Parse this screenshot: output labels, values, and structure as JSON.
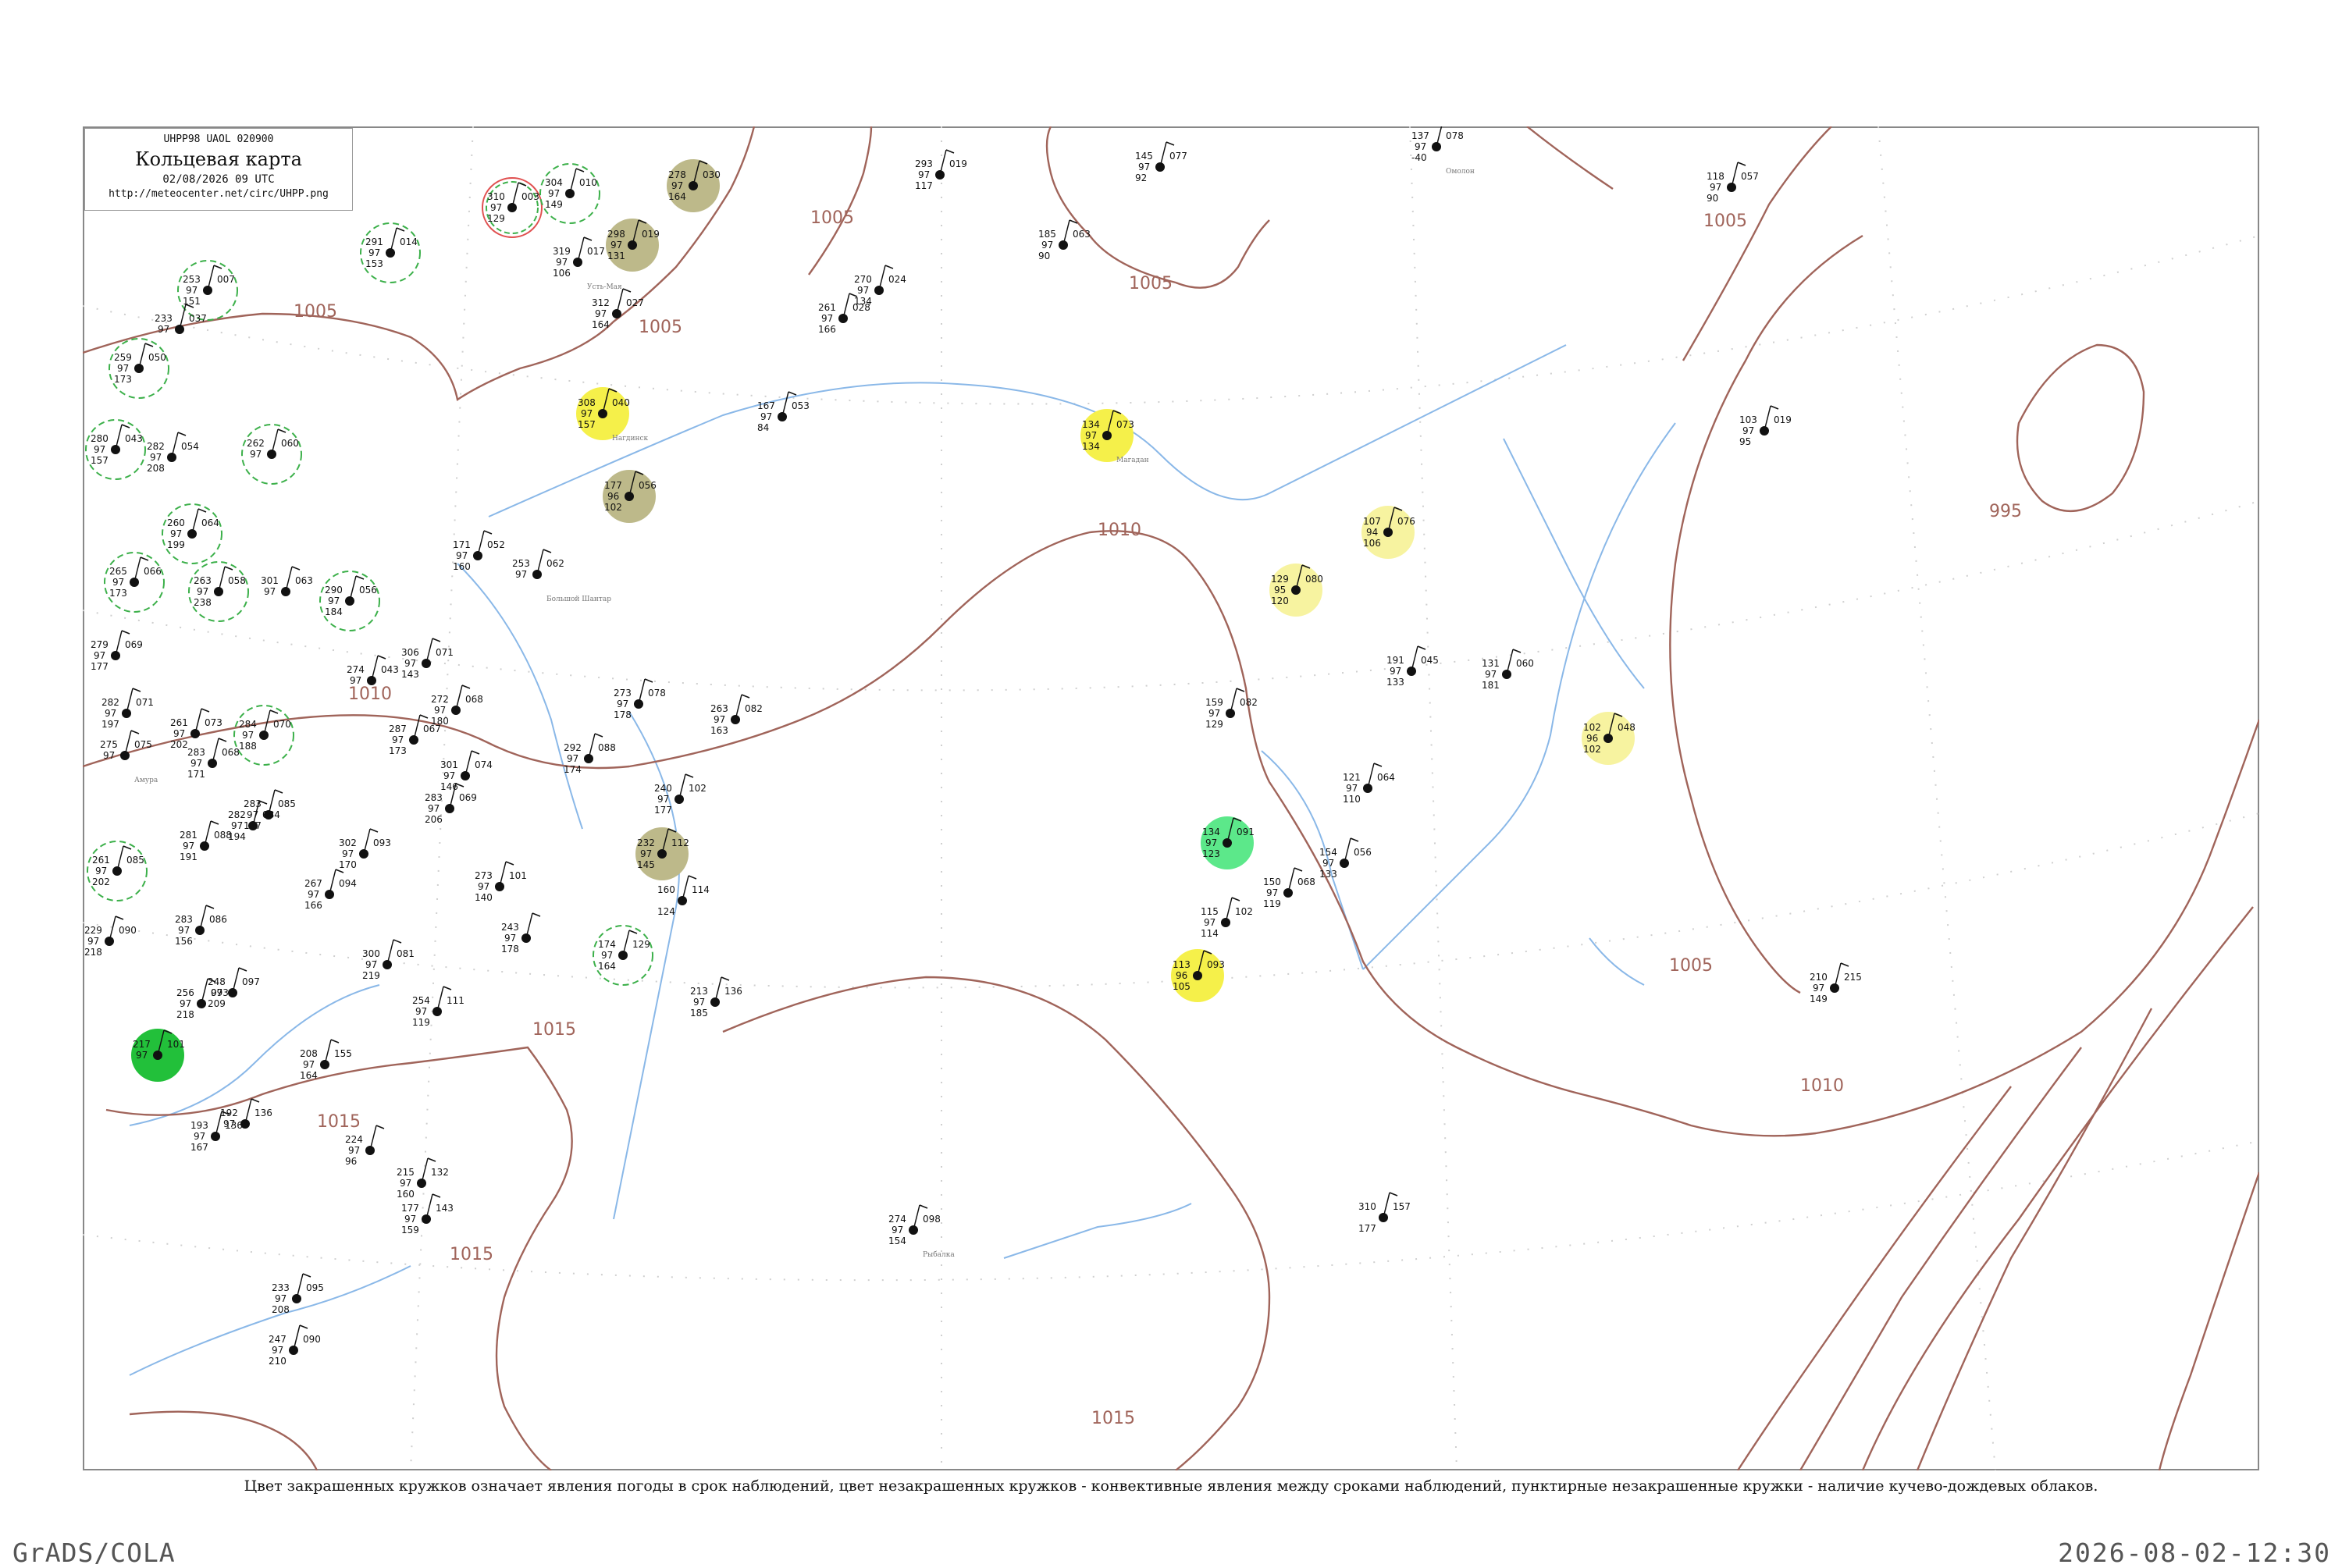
{
  "header": {
    "code": "UHPP98  UAOL  020900",
    "title": "Кольцевая карта",
    "date": "02/08/2026 09 UTC",
    "url": "http://meteocenter.net/circ/UHPP.png"
  },
  "caption": "Цвет закрашенных кружков означает явления погоды в срок наблюдений, цвет незакрашенных кружков - конвективные явления между сроками наблюдений, пунктирные незакрашенные кружки - наличие кучево-дождевых облаков.",
  "footer": {
    "left": "GrADS/COLA",
    "right": "2026-08-02-12:30"
  },
  "colors": {
    "isobar": "#a0645a",
    "river": "#8ab8e8",
    "dashed_circle": "#3cb04a",
    "yellow": "#f5f04a",
    "olive": "#bdb98a",
    "green": "#22c03a",
    "mint": "#5ce88a",
    "pale_yellow": "#f7f3a0",
    "red_circle": "#e05050"
  },
  "isobar_labels": [
    {
      "id": "a",
      "text": "1005"
    },
    {
      "id": "b",
      "text": "1005"
    },
    {
      "id": "c",
      "text": "1005"
    },
    {
      "id": "d",
      "text": "1005"
    },
    {
      "id": "e",
      "text": "1005"
    },
    {
      "id": "f",
      "text": "1005"
    },
    {
      "id": "g",
      "text": "995"
    },
    {
      "id": "h",
      "text": "1010"
    },
    {
      "id": "i",
      "text": "1010"
    },
    {
      "id": "j",
      "text": "1010"
    },
    {
      "id": "k",
      "text": "1015"
    },
    {
      "id": "l",
      "text": "1015"
    },
    {
      "id": "m",
      "text": "1015"
    },
    {
      "id": "n",
      "text": "1015"
    }
  ],
  "stations": [
    {
      "p": "310",
      "v": "97",
      "t": "129",
      "d": "003",
      "name": "",
      "mark": "red"
    },
    {
      "p": "304",
      "v": "97",
      "t": "149",
      "d": "010",
      "name": "",
      "mark": "dashed"
    },
    {
      "p": "278",
      "v": "97",
      "t": "164",
      "d": "030",
      "name": "",
      "mark": "olive"
    },
    {
      "p": "319",
      "v": "97",
      "t": "106",
      "d": "017",
      "name": "Усть-Мая",
      "mark": "none"
    },
    {
      "p": "298",
      "v": "97",
      "t": "131",
      "d": "019",
      "name": "",
      "mark": "olive"
    },
    {
      "p": "312",
      "v": "97",
      "t": "164",
      "d": "027",
      "name": "",
      "mark": "none"
    },
    {
      "p": "308",
      "v": "97",
      "t": "157",
      "d": "040",
      "name": "Нагдинск",
      "mark": "yellow"
    },
    {
      "p": "291",
      "v": "97",
      "t": "153",
      "d": "014",
      "name": "",
      "mark": "dashed"
    },
    {
      "p": "253",
      "v": "97",
      "t": "151",
      "d": "007",
      "name": "",
      "mark": "dashed"
    },
    {
      "p": "233",
      "v": "97",
      "t": "",
      "d": "037",
      "name": "",
      "mark": "none"
    },
    {
      "p": "259",
      "v": "97",
      "t": "173",
      "d": "050",
      "name": "",
      "mark": "dashed"
    },
    {
      "p": "280",
      "v": "97",
      "t": "157",
      "d": "043",
      "name": "",
      "mark": "dashed"
    },
    {
      "p": "282",
      "v": "97",
      "t": "208",
      "d": "054",
      "name": "",
      "mark": "none"
    },
    {
      "p": "262",
      "v": "97",
      "t": "",
      "d": "060",
      "name": "",
      "mark": "dashed"
    },
    {
      "p": "260",
      "v": "97",
      "t": "199",
      "d": "064",
      "name": "",
      "mark": "dashed"
    },
    {
      "p": "265",
      "v": "97",
      "t": "173",
      "d": "066",
      "name": "",
      "mark": "dashed"
    },
    {
      "p": "263",
      "v": "97",
      "t": "238",
      "d": "058",
      "name": "",
      "mark": "dashed"
    },
    {
      "p": "301",
      "v": "97",
      "t": "",
      "d": "063",
      "name": "",
      "mark": "none"
    },
    {
      "p": "290",
      "v": "97",
      "t": "184",
      "d": "056",
      "name": "",
      "mark": "dashed"
    },
    {
      "p": "279",
      "v": "97",
      "t": "177",
      "d": "069",
      "name": "",
      "mark": "none"
    },
    {
      "p": "282",
      "v": "97",
      "t": "197",
      "d": "071",
      "name": "",
      "mark": "none"
    },
    {
      "p": "261",
      "v": "97",
      "t": "202",
      "d": "073",
      "name": "",
      "mark": "none"
    },
    {
      "p": "284",
      "v": "97",
      "t": "188",
      "d": "070",
      "name": "",
      "mark": "dashed"
    },
    {
      "p": "275",
      "v": "97",
      "t": "",
      "d": "075",
      "name": "Амура",
      "mark": "none"
    },
    {
      "p": "283",
      "v": "97",
      "t": "171",
      "d": "068",
      "name": "",
      "mark": "none"
    },
    {
      "p": "283",
      "v": "97",
      "t": "197",
      "d": "085",
      "name": "",
      "mark": "none"
    },
    {
      "p": "282",
      "v": "97",
      "t": "194",
      "d": "084",
      "name": "",
      "mark": "none"
    },
    {
      "p": "281",
      "v": "97",
      "t": "191",
      "d": "088",
      "name": "",
      "mark": "none"
    },
    {
      "p": "261",
      "v": "97",
      "t": "202",
      "d": "085",
      "name": "",
      "mark": "dashed"
    },
    {
      "p": "229",
      "v": "97",
      "t": "218",
      "d": "090",
      "name": "",
      "mark": "none"
    },
    {
      "p": "283",
      "v": "97",
      "t": "156",
      "d": "086",
      "name": "",
      "mark": "none"
    },
    {
      "p": "248",
      "v": "97",
      "t": "209",
      "d": "097",
      "name": "",
      "mark": "none"
    },
    {
      "p": "256",
      "v": "97",
      "t": "218",
      "d": "093",
      "name": "",
      "mark": "none"
    },
    {
      "p": "217",
      "v": "97",
      "t": "",
      "d": "101",
      "name": "",
      "mark": "green"
    },
    {
      "p": "274",
      "v": "97",
      "t": "",
      "d": "043",
      "name": "",
      "mark": "none"
    },
    {
      "p": "306",
      "v": "97",
      "t": "143",
      "d": "071",
      "name": "",
      "mark": "none"
    },
    {
      "p": "272",
      "v": "97",
      "t": "180",
      "d": "068",
      "name": "",
      "mark": "none"
    },
    {
      "p": "287",
      "v": "97",
      "t": "173",
      "d": "067",
      "name": "",
      "mark": "none"
    },
    {
      "p": "301",
      "v": "97",
      "t": "146",
      "d": "074",
      "name": "",
      "mark": "none"
    },
    {
      "p": "283",
      "v": "97",
      "t": "206",
      "d": "069",
      "name": "",
      "mark": "none"
    },
    {
      "p": "302",
      "v": "97",
      "t": "170",
      "d": "093",
      "name": "",
      "mark": "none"
    },
    {
      "p": "267",
      "v": "97",
      "t": "166",
      "d": "094",
      "name": "",
      "mark": "none"
    },
    {
      "p": "300",
      "v": "97",
      "t": "219",
      "d": "081",
      "name": "",
      "mark": "none"
    },
    {
      "p": "254",
      "v": "97",
      "t": "119",
      "d": "111",
      "name": "",
      "mark": "none"
    },
    {
      "p": "208",
      "v": "97",
      "t": "164",
      "d": "155",
      "name": "",
      "mark": "none"
    },
    {
      "p": "193",
      "v": "97",
      "t": "167",
      "d": "136",
      "name": "",
      "mark": "none"
    },
    {
      "p": "192",
      "v": "97",
      "t": "",
      "d": "136",
      "name": "",
      "mark": "none"
    },
    {
      "p": "171",
      "v": "97",
      "t": "160",
      "d": "052",
      "name": "",
      "mark": "none"
    },
    {
      "p": "253",
      "v": "97",
      "t": "",
      "d": "062",
      "name": "Большой Шантар",
      "mark": "none"
    },
    {
      "p": "177",
      "v": "96",
      "t": "102",
      "d": "056",
      "name": "",
      "mark": "olive"
    },
    {
      "p": "167",
      "v": "97",
      "t": "84",
      "d": "053",
      "name": "",
      "mark": "none"
    },
    {
      "p": "273",
      "v": "97",
      "t": "178",
      "d": "078",
      "name": "",
      "mark": "none"
    },
    {
      "p": "263",
      "v": "97",
      "t": "163",
      "d": "082",
      "name": "",
      "mark": "none"
    },
    {
      "p": "292",
      "v": "97",
      "t": "174",
      "d": "088",
      "name": "",
      "mark": "none"
    },
    {
      "p": "240",
      "v": "97",
      "t": "177",
      "d": "102",
      "name": "",
      "mark": "none"
    },
    {
      "p": "232",
      "v": "97",
      "t": "145",
      "d": "112",
      "name": "",
      "mark": "olive"
    },
    {
      "p": "273",
      "v": "97",
      "t": "140",
      "d": "101",
      "name": "",
      "mark": "none"
    },
    {
      "p": "243",
      "v": "97",
      "t": "178",
      "d": "",
      "name": "",
      "mark": "none"
    },
    {
      "p": "174",
      "v": "97",
      "t": "164",
      "d": "129",
      "name": "",
      "mark": "dashed"
    },
    {
      "p": "160",
      "v": "",
      "t": "124",
      "d": "114",
      "name": "",
      "mark": "none"
    },
    {
      "p": "213",
      "v": "97",
      "t": "185",
      "d": "136",
      "name": "",
      "mark": "none"
    },
    {
      "p": "224",
      "v": "97",
      "t": "96",
      "d": "",
      "name": "",
      "mark": "none"
    },
    {
      "p": "215",
      "v": "97",
      "t": "160",
      "d": "132",
      "name": "",
      "mark": "none"
    },
    {
      "p": "177",
      "v": "97",
      "t": "159",
      "d": "143",
      "name": "",
      "mark": "none"
    },
    {
      "p": "233",
      "v": "97",
      "t": "208",
      "d": "095",
      "name": "",
      "mark": "none"
    },
    {
      "p": "247",
      "v": "97",
      "t": "210",
      "d": "090",
      "name": "",
      "mark": "none"
    },
    {
      "p": "274",
      "v": "97",
      "t": "154",
      "d": "098",
      "name": "Рыбалка",
      "mark": "none"
    },
    {
      "p": "270",
      "v": "97",
      "t": "134",
      "d": "024",
      "name": "",
      "mark": "none"
    },
    {
      "p": "261",
      "v": "97",
      "t": "166",
      "d": "028",
      "name": "",
      "mark": "none"
    },
    {
      "p": "293",
      "v": "97",
      "t": "117",
      "d": "019",
      "name": "",
      "mark": "none"
    },
    {
      "p": "185",
      "v": "97",
      "t": "90",
      "d": "063",
      "name": "",
      "mark": "none"
    },
    {
      "p": "145",
      "v": "97",
      "t": "92",
      "d": "077",
      "name": "",
      "mark": "none"
    },
    {
      "p": "137",
      "v": "97",
      "t": "-40",
      "d": "078",
      "name": "Омолон",
      "mark": "none"
    },
    {
      "p": "118",
      "v": "97",
      "t": "90",
      "d": "057",
      "name": "",
      "mark": "none"
    },
    {
      "p": "134",
      "v": "97",
      "t": "134",
      "d": "073",
      "name": "Магадан",
      "mark": "yellow"
    },
    {
      "p": "107",
      "v": "94",
      "t": "106",
      "d": "076",
      "name": "",
      "mark": "pale"
    },
    {
      "p": "129",
      "v": "95",
      "t": "120",
      "d": "080",
      "name": "",
      "mark": "pale"
    },
    {
      "p": "191",
      "v": "97",
      "t": "133",
      "d": "045",
      "name": "",
      "mark": "none"
    },
    {
      "p": "131",
      "v": "97",
      "t": "181",
      "d": "060",
      "name": "",
      "mark": "none"
    },
    {
      "p": "159",
      "v": "97",
      "t": "129",
      "d": "082",
      "name": "",
      "mark": "none"
    },
    {
      "p": "102",
      "v": "96",
      "t": "102",
      "d": "048",
      "name": "",
      "mark": "pale"
    },
    {
      "p": "121",
      "v": "97",
      "t": "110",
      "d": "064",
      "name": "",
      "mark": "none"
    },
    {
      "p": "134",
      "v": "97",
      "t": "123",
      "d": "091",
      "name": "",
      "mark": "mint"
    },
    {
      "p": "154",
      "v": "97",
      "t": "133",
      "d": "056",
      "name": "",
      "mark": "none"
    },
    {
      "p": "150",
      "v": "97",
      "t": "119",
      "d": "068",
      "name": "",
      "mark": "none"
    },
    {
      "p": "115",
      "v": "97",
      "t": "114",
      "d": "102",
      "name": "",
      "mark": "none"
    },
    {
      "p": "113",
      "v": "96",
      "t": "105",
      "d": "093",
      "name": "",
      "mark": "yellow"
    },
    {
      "p": "103",
      "v": "97",
      "t": "95",
      "d": "019",
      "name": "",
      "mark": "none"
    },
    {
      "p": "210",
      "v": "97",
      "t": "149",
      "d": "215",
      "name": "",
      "mark": "none"
    },
    {
      "p": "310",
      "v": "",
      "t": "177",
      "d": "157",
      "name": "",
      "mark": "none"
    }
  ]
}
